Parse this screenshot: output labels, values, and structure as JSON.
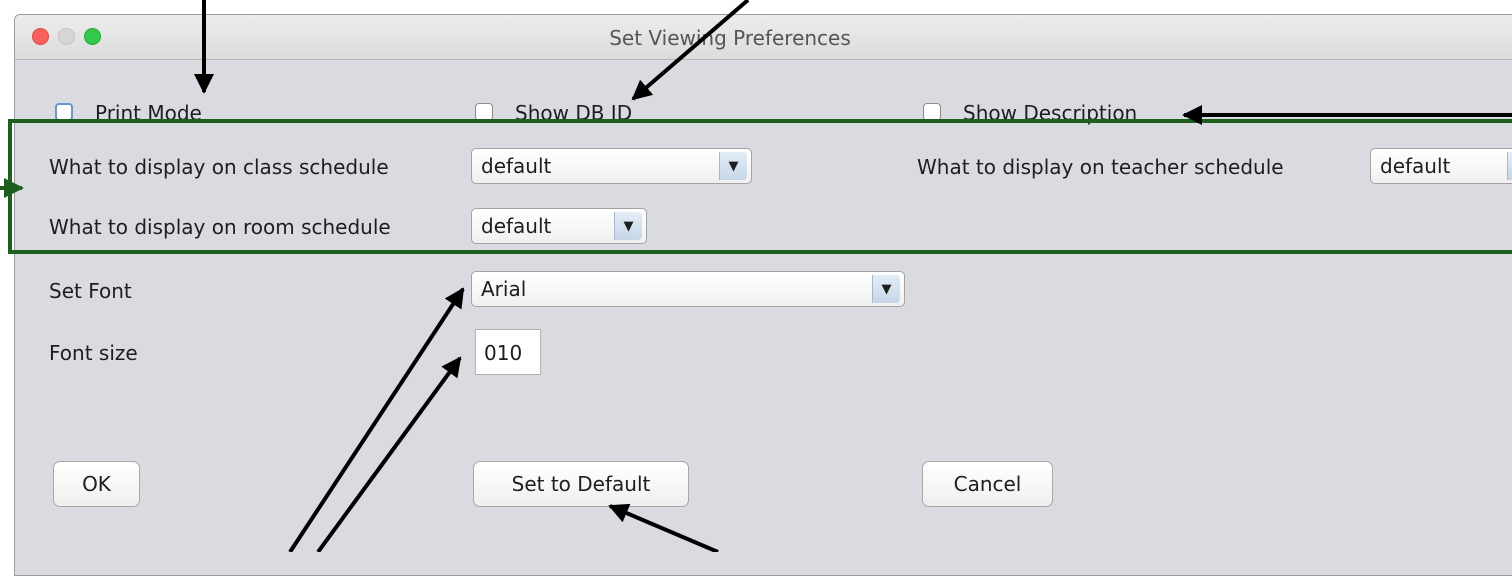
{
  "window": {
    "title": "Set Viewing Preferences"
  },
  "checkboxes": {
    "print_mode": "Print Mode",
    "show_db_id": "Show DB ID",
    "show_description": "Show Description"
  },
  "schedule": {
    "class_label": "What to display on class schedule",
    "class_value": "default",
    "teacher_label": "What to display on teacher schedule",
    "teacher_value": "default",
    "room_label": "What to display on room schedule",
    "room_value": "default"
  },
  "font": {
    "label": "Set Font",
    "value": "Arial",
    "size_label": "Font size",
    "size_value": "010"
  },
  "buttons": {
    "ok": "OK",
    "set_default": "Set to Default",
    "cancel": "Cancel"
  },
  "icons": {
    "dropdown": "▼"
  },
  "colors": {
    "group_border": "#1e5e1e",
    "annotation_arrow": "#000000"
  }
}
